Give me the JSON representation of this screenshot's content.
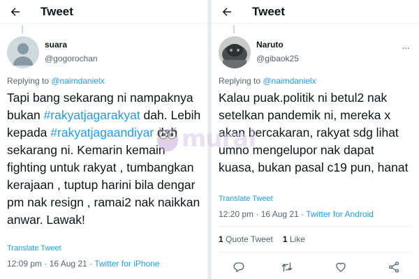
{
  "left": {
    "header_title": "Tweet",
    "user_name": "suara",
    "handle": "@gogorochan",
    "replying_prefix": "Replying to ",
    "replying_handle": "@naimdanielx",
    "body_parts": [
      {
        "t": "Tapi bang sekarang ni nampaknya bukan ",
        "h": false
      },
      {
        "t": "#rakyatjagarakyat",
        "h": true
      },
      {
        "t": " dah. Lebih kepada ",
        "h": false
      },
      {
        "t": "#rakyatjagaandiyar",
        "h": true
      },
      {
        "t": " dah sekarang ni. Kemarin kemain fighting untuk rakyat , tumbangkan kerajaan , tuptup harini bila dengar pm nak resign , ramai2 nak naikkan anwar. Lawak!",
        "h": false
      }
    ],
    "translate_label": "Translate Tweet",
    "timestamp": "12:09 pm · 16 Aug 21 · ",
    "source": "Twitter for iPhone"
  },
  "right": {
    "header_title": "Tweet",
    "user_name": "Naruto",
    "handle": "@gibaok25",
    "replying_prefix": "Replying to ",
    "replying_handle": "@naimdanielx",
    "body_text": "Kalau puak.politik ni betul2 nak setelkan pandemik ni, mereka x akan bercakaran, rakyat sdg lihat umno mengelupor nak dapat kuasa, bukan pasal c19 pun, hanat",
    "translate_label": "Translate Tweet",
    "timestamp": "12:20 pm · 16 Aug 21 · ",
    "source": "Twitter for Android",
    "quote_count": "1",
    "quote_label": " Quote Tweet",
    "like_count": "1",
    "like_label": " Like"
  },
  "watermark": "murai",
  "icons": {
    "back": "arrow-left-icon",
    "more": "more-dots-icon",
    "reply": "comment-icon",
    "retweet": "retweet-icon",
    "like": "heart-icon",
    "share": "share-icon"
  },
  "colors": {
    "link": "#1d9bf0",
    "text": "#0f1419",
    "muted": "#536471",
    "divider": "#e9ecee"
  }
}
